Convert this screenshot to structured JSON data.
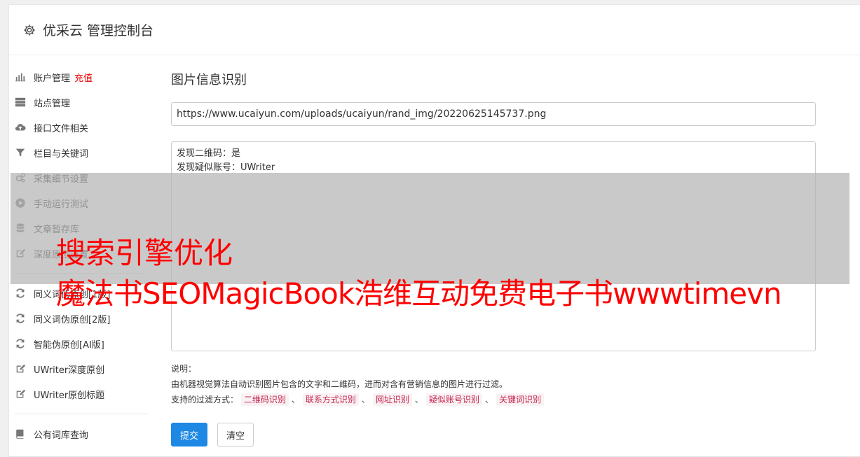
{
  "header": {
    "title": "优采云 管理控制台",
    "icon": "gear-icon"
  },
  "sidebar": {
    "group1": [
      {
        "label": "账户管理",
        "tag": "充值",
        "icon": "bar-chart-icon"
      },
      {
        "label": "站点管理",
        "icon": "server-icon"
      },
      {
        "label": "接口文件相关",
        "icon": "cloud-upload-icon"
      },
      {
        "label": "栏目与关键词",
        "icon": "filter-icon"
      },
      {
        "label": "采集细节设置",
        "icon": "gears-icon"
      },
      {
        "label": "手动运行测试",
        "icon": "play-circle-icon"
      },
      {
        "label": "文章暂存库",
        "icon": "database-icon"
      },
      {
        "label": "深度原创设置",
        "icon": "edit-icon"
      }
    ],
    "group2": [
      {
        "label": "同义词伪原创[1版]",
        "icon": "refresh-icon"
      },
      {
        "label": "同义词伪原创[2版]",
        "icon": "refresh-icon"
      },
      {
        "label": "智能伪原创[AI版]",
        "icon": "refresh-icon"
      },
      {
        "label": "UWriter深度原创",
        "icon": "edit-icon"
      },
      {
        "label": "UWriter原创标题",
        "icon": "edit-icon"
      }
    ],
    "group3": [
      {
        "label": "公有词库查询",
        "icon": "book-icon"
      }
    ]
  },
  "main": {
    "title": "图片信息识别",
    "url_value": "https://www.ucaiyun.com/uploads/ucaiyun/rand_img/20220625145737.png",
    "result_lines": [
      "发现二维码：是",
      "发现疑似账号：UWriter"
    ],
    "notes_label": "说明：",
    "notes_desc": "由机器视觉算法自动识别图片包含的文字和二维码，进而对含有营销信息的图片进行过滤。",
    "filters_label": "支持的过滤方式：",
    "filters": [
      "二维码识别",
      "联系方式识别",
      "网址识别",
      "疑似账号识别",
      "关键词识别"
    ],
    "filter_separator": "、",
    "submit_label": "提交",
    "clear_label": "清空"
  },
  "watermark": {
    "line1": "搜索引擎优化",
    "line2": "魔法书SEOMagicBook浩维互动免费电子书wwwtimevn"
  },
  "colors": {
    "primary": "#1e88e5",
    "tag": "#ee0000",
    "watermark": "#ff0000",
    "chip_text": "#c7254e",
    "chip_bg": "#f9f2f4"
  }
}
